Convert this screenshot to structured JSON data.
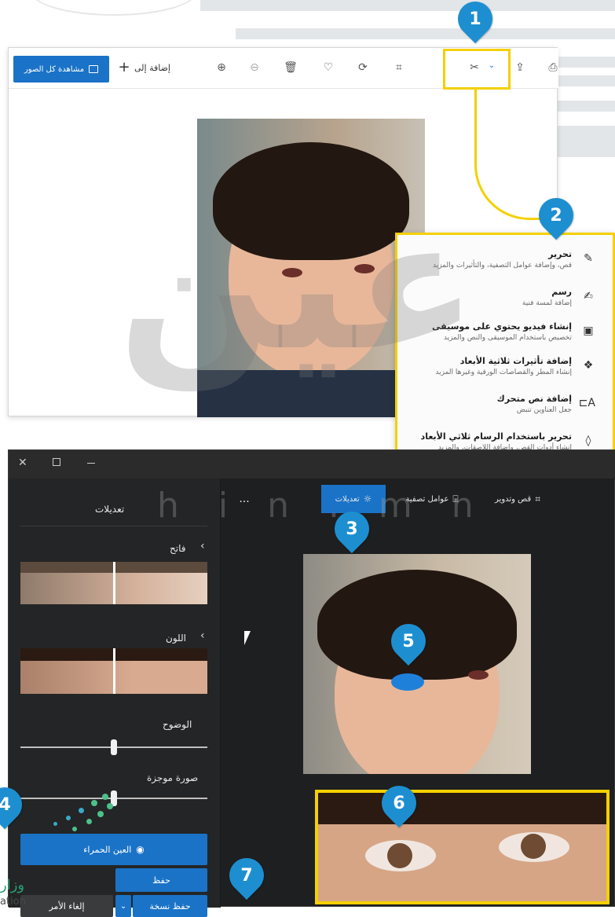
{
  "top_window": {
    "view_all_label": "مشاهدة كل الصور",
    "add_to_label": "إضافة إلى",
    "icons": [
      "plus-icon",
      "zoom-in-icon",
      "zoom-out-icon",
      "delete-icon",
      "heart-icon",
      "rotate-icon",
      "crop-icon",
      "edit-create-icon",
      "chevron-down-icon",
      "share-icon"
    ]
  },
  "edit_menu": {
    "items": [
      {
        "title": "تحرير",
        "subtitle": "قص، وإضافة عوامل التصفية، والتأثيرات والمزيد",
        "icon": "edit-icon"
      },
      {
        "title": "رسم",
        "subtitle": "إضافة لمسة فنية",
        "icon": "draw-icon"
      },
      {
        "title": "إنشاء فيديو يحتوي على موسيقى",
        "subtitle": "تخصيص باستخدام الموسيقى والنص والمزيد",
        "icon": "video-icon"
      },
      {
        "title": "إضافة تأثيرات ثلاثية الأبعاد",
        "subtitle": "إنشاء المطر والقصاصات الورقية وغيرها المزيد",
        "icon": "effects-3d-icon"
      },
      {
        "title": "إضافة نص متحرك",
        "subtitle": "جعل العناوين تنبض",
        "icon": "animated-text-icon"
      },
      {
        "title": "تحرير باستخدام الرسام ثلاثي الأبعاد",
        "subtitle": "إنشاء أدوات القص، وإضافة اللاصقات، والمزيد",
        "icon": "paint3d-icon"
      }
    ]
  },
  "editor": {
    "panel_title": "تعديلات",
    "light_label": "فاتح",
    "color_label": "اللون",
    "clarity_label": "الوضوح",
    "vignette_label": "صورة موجزة",
    "red_eye_label": "العين الحمراء",
    "save_label": "حفظ",
    "save_copy_label": "حفظ نسخة",
    "cancel_label": "إلغاء الأمر",
    "tabs": {
      "crop_rotate": "قص وتدوير",
      "filters": "عوامل تصفية",
      "adjustments": "تعديلات",
      "more": "..."
    },
    "slider_levels": {
      "clarity": 0.5,
      "vignette": 0.5
    }
  },
  "markers": [
    "1",
    "2",
    "3",
    "4",
    "5",
    "6",
    "7"
  ],
  "watermark": {
    "arabic": "عين",
    "latin": "h i n . m n"
  },
  "ministry": {
    "arabic_fragment": "وزار",
    "latin_fragment": "ation"
  },
  "colors": {
    "accent": "#1a73c7",
    "highlight": "#f4d000",
    "marker": "#1d8fd0",
    "editor_bg": "#1e1f20"
  }
}
